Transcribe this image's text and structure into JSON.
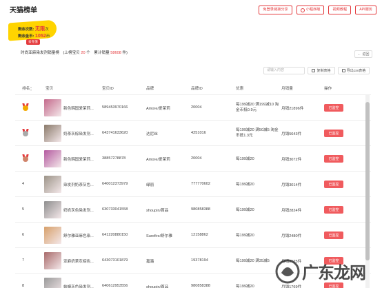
{
  "page": {
    "title": "天猫榜单"
  },
  "top_buttons": [
    {
      "label": "免登录链接分享",
      "icon": ""
    },
    {
      "label": "小程序版",
      "icon": "link-icon"
    },
    {
      "label": "视频教程",
      "icon": ""
    },
    {
      "label": "API服务",
      "icon": ""
    }
  ],
  "quota": {
    "remaining_label": "剩余次数:",
    "remaining_value": "无限",
    "remaining_unit": "次",
    "coins_label": "剩余金币:",
    "coins_value": "1052",
    "coins_unit": "币",
    "recharge_label": "去充值"
  },
  "summary": {
    "category": "时尚亚麻染发剂销量榜",
    "count_prefix": "(上榜宝贝",
    "count_value": "20",
    "count_suffix": "个",
    "sales_prefix": "累计销量",
    "sales_value": "58608",
    "sales_suffix": "件)"
  },
  "back_button": {
    "label": "返回",
    "icon": "back-arrow-icon"
  },
  "search": {
    "placeholder": "请输入内容"
  },
  "tools": {
    "copy_label": "复制表格",
    "export_label": "导出csv表格"
  },
  "table": {
    "headers": {
      "rank": "排名",
      "product": "宝贝",
      "product_id": "宝贝ID",
      "brand": "品牌",
      "brand_id": "品牌ID",
      "promo": "优惠",
      "monthly_sales": "月销量",
      "action": "操作"
    },
    "rows": [
      {
        "rank": "",
        "medal": "gold",
        "name": "新色韩国爱茉莉...",
        "id": "589453970166",
        "brand": "Amore/爱茉莉",
        "brand_id": "20004",
        "promo": "每199减20 满199减10 淘金币抵0.9元",
        "sales": "月销21896件",
        "action": "已监控",
        "thumb": "#c46a8c"
      },
      {
        "rank": "",
        "medal": "silver",
        "name": "奶茶灰棕染发剂...",
        "id": "643741633620",
        "brand": "达尼丝",
        "brand_id": "4251016",
        "promo": "每199减20 满50减5 淘金币抵1.3元",
        "sales": "月销5643件",
        "action": "已监控",
        "thumb": "#8a7a6a"
      },
      {
        "rank": "",
        "medal": "bronze",
        "name": "新色韩国爱茉莉...",
        "id": "38857278878",
        "brand": "Amore/爱茉莉",
        "brand_id": "20004",
        "promo": "每199减20",
        "sales": "月销3072件",
        "action": "已监控",
        "thumb": "#b45aa0"
      },
      {
        "rank": "4",
        "medal": "",
        "name": "染发剂奶茶灰色...",
        "id": "640012373979",
        "brand": "绿丽",
        "brand_id": "777770602",
        "promo": "每199减20",
        "sales": "月销3014件",
        "action": "已监控",
        "thumb": "#9c9488"
      },
      {
        "rank": "5",
        "medal": "",
        "name": "奶奶灰色染发剂...",
        "id": "630733041558",
        "brand": "shoupin/首品",
        "brand_id": "980858388",
        "promo": "每199减20",
        "sales": "月销2824件",
        "action": "已监控",
        "thumb": "#8e8e8e"
      },
      {
        "rank": "6",
        "medal": "",
        "name": "舒尔雅亚麻色染...",
        "id": "641220880150",
        "brand": "Surefire/舒尔雅",
        "brand_id": "12158862",
        "promo": "每199减20",
        "sales": "月销2480件",
        "action": "已监控",
        "thumb": "#d7a06a"
      },
      {
        "rank": "7",
        "medal": "",
        "name": "亚麻奶茶灰棕色...",
        "id": "643073101879",
        "brand": "嘉潞",
        "brand_id": "19378194",
        "promo": "每199减20 满35减5",
        "sales": "月销2125件",
        "action": "已监控",
        "thumb": "#a86a6a"
      },
      {
        "rank": "8",
        "medal": "",
        "name": "蛤蟆灰色染发剂...",
        "id": "640612953556",
        "brand": "shoupin/首品",
        "brand_id": "980858388",
        "promo": "每199减20",
        "sales": "月销1769件",
        "action": "已监控",
        "thumb": "#9a9a9a"
      }
    ]
  },
  "watermark": {
    "text": "广东龙网"
  },
  "colors": {
    "accent": "#e4393c",
    "gold": "#f2a900",
    "silver": "#a9a9a9",
    "bronze": "#d0846a",
    "quota_yellow": "#ffd400"
  }
}
